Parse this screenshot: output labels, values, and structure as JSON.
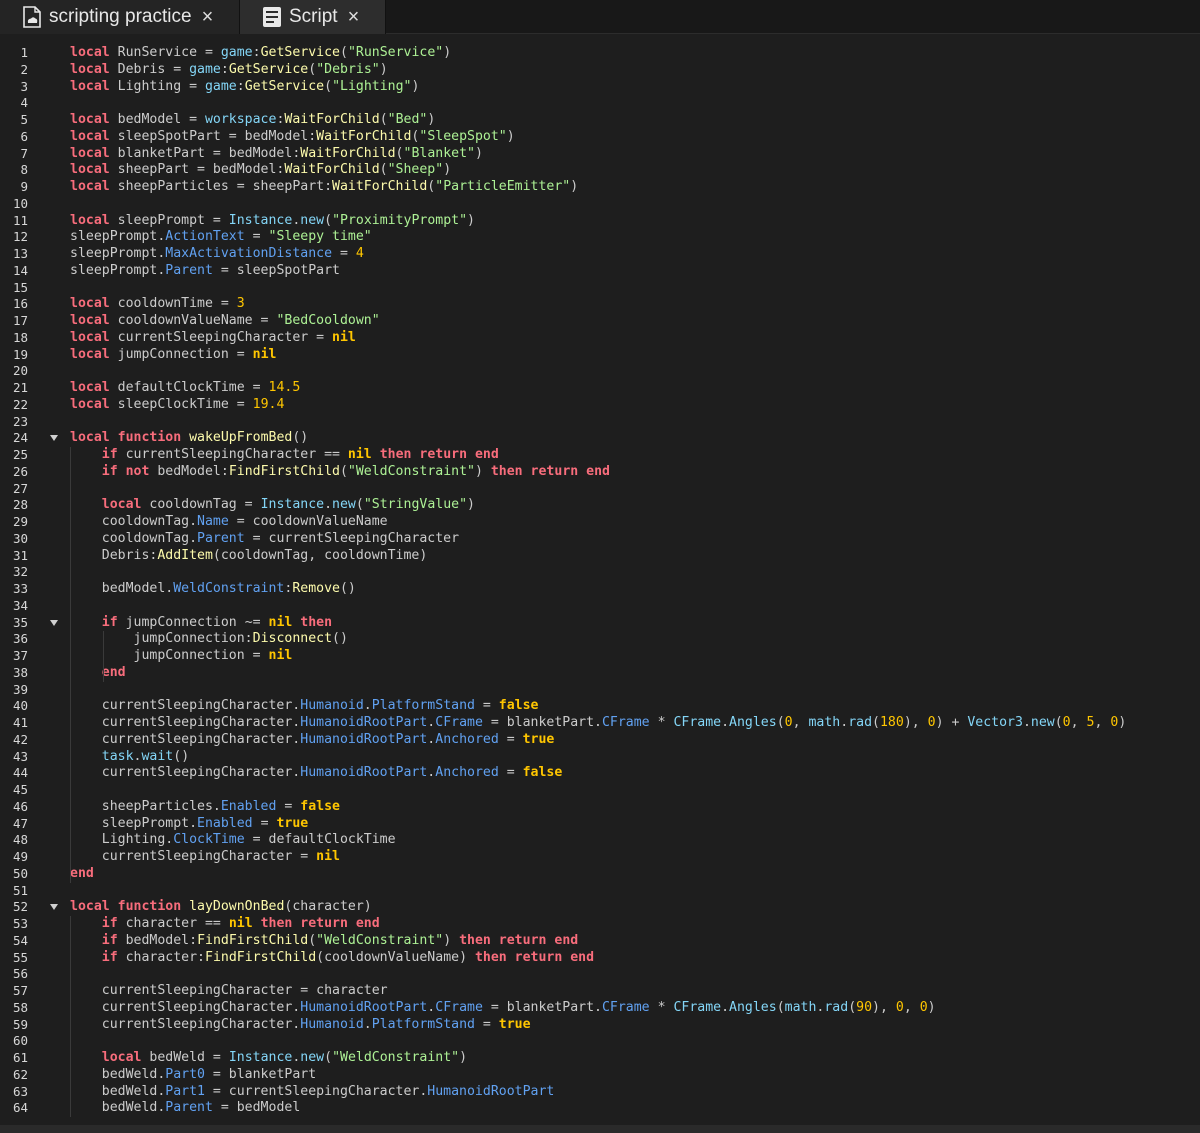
{
  "tabs": [
    {
      "label": "scripting practice",
      "icon": "place-file-icon",
      "close": "×"
    },
    {
      "label": "Script",
      "icon": "script-document-icon",
      "close": "×"
    }
  ],
  "colors": {
    "background": "#1e1e1e",
    "keyword": "#f86d7c",
    "literal": "#ffc600",
    "string": "#adf195",
    "method": "#fdfbac",
    "property": "#61a1f1",
    "builtin": "#84d6f7",
    "text": "#cccccc"
  },
  "fold_lines": [
    24,
    35,
    52
  ],
  "code_lines": [
    [
      [
        "kw",
        "local"
      ],
      [
        "op",
        " RunService = "
      ],
      [
        "blt",
        "game"
      ],
      [
        "op",
        ":"
      ],
      [
        "fn",
        "GetService"
      ],
      [
        "op",
        "("
      ],
      [
        "str",
        "\"RunService\""
      ],
      [
        "op",
        ")"
      ]
    ],
    [
      [
        "kw",
        "local"
      ],
      [
        "op",
        " Debris = "
      ],
      [
        "blt",
        "game"
      ],
      [
        "op",
        ":"
      ],
      [
        "fn",
        "GetService"
      ],
      [
        "op",
        "("
      ],
      [
        "str",
        "\"Debris\""
      ],
      [
        "op",
        ")"
      ]
    ],
    [
      [
        "kw",
        "local"
      ],
      [
        "op",
        " Lighting = "
      ],
      [
        "blt",
        "game"
      ],
      [
        "op",
        ":"
      ],
      [
        "fn",
        "GetService"
      ],
      [
        "op",
        "("
      ],
      [
        "str",
        "\"Lighting\""
      ],
      [
        "op",
        ")"
      ]
    ],
    [],
    [
      [
        "kw",
        "local"
      ],
      [
        "op",
        " bedModel = "
      ],
      [
        "blt",
        "workspace"
      ],
      [
        "op",
        ":"
      ],
      [
        "fn",
        "WaitForChild"
      ],
      [
        "op",
        "("
      ],
      [
        "str",
        "\"Bed\""
      ],
      [
        "op",
        ")"
      ]
    ],
    [
      [
        "kw",
        "local"
      ],
      [
        "op",
        " sleepSpotPart = bedModel:"
      ],
      [
        "fn",
        "WaitForChild"
      ],
      [
        "op",
        "("
      ],
      [
        "str",
        "\"SleepSpot\""
      ],
      [
        "op",
        ")"
      ]
    ],
    [
      [
        "kw",
        "local"
      ],
      [
        "op",
        " blanketPart = bedModel:"
      ],
      [
        "fn",
        "WaitForChild"
      ],
      [
        "op",
        "("
      ],
      [
        "str",
        "\"Blanket\""
      ],
      [
        "op",
        ")"
      ]
    ],
    [
      [
        "kw",
        "local"
      ],
      [
        "op",
        " sheepPart = bedModel:"
      ],
      [
        "fn",
        "WaitForChild"
      ],
      [
        "op",
        "("
      ],
      [
        "str",
        "\"Sheep\""
      ],
      [
        "op",
        ")"
      ]
    ],
    [
      [
        "kw",
        "local"
      ],
      [
        "op",
        " sheepParticles = sheepPart:"
      ],
      [
        "fn",
        "WaitForChild"
      ],
      [
        "op",
        "("
      ],
      [
        "str",
        "\"ParticleEmitter\""
      ],
      [
        "op",
        ")"
      ]
    ],
    [],
    [
      [
        "kw",
        "local"
      ],
      [
        "op",
        " sleepPrompt = "
      ],
      [
        "blt",
        "Instance"
      ],
      [
        "op",
        "."
      ],
      [
        "blt",
        "new"
      ],
      [
        "op",
        "("
      ],
      [
        "str",
        "\"ProximityPrompt\""
      ],
      [
        "op",
        ")"
      ]
    ],
    [
      [
        "op",
        "sleepPrompt."
      ],
      [
        "prop",
        "ActionText"
      ],
      [
        "op",
        " = "
      ],
      [
        "str",
        "\"Sleepy time\""
      ]
    ],
    [
      [
        "op",
        "sleepPrompt."
      ],
      [
        "prop",
        "MaxActivationDistance"
      ],
      [
        "op",
        " = "
      ],
      [
        "num",
        "4"
      ]
    ],
    [
      [
        "op",
        "sleepPrompt."
      ],
      [
        "prop",
        "Parent"
      ],
      [
        "op",
        " = sleepSpotPart"
      ]
    ],
    [],
    [
      [
        "kw",
        "local"
      ],
      [
        "op",
        " cooldownTime = "
      ],
      [
        "num",
        "3"
      ]
    ],
    [
      [
        "kw",
        "local"
      ],
      [
        "op",
        " cooldownValueName = "
      ],
      [
        "str",
        "\"BedCooldown\""
      ]
    ],
    [
      [
        "kw",
        "local"
      ],
      [
        "op",
        " currentSleepingCharacter = "
      ],
      [
        "lit",
        "nil"
      ]
    ],
    [
      [
        "kw",
        "local"
      ],
      [
        "op",
        " jumpConnection = "
      ],
      [
        "lit",
        "nil"
      ]
    ],
    [],
    [
      [
        "kw",
        "local"
      ],
      [
        "op",
        " defaultClockTime = "
      ],
      [
        "num",
        "14.5"
      ]
    ],
    [
      [
        "kw",
        "local"
      ],
      [
        "op",
        " sleepClockTime = "
      ],
      [
        "num",
        "19.4"
      ]
    ],
    [],
    [
      [
        "kw",
        "local function"
      ],
      [
        "op",
        " "
      ],
      [
        "fn",
        "wakeUpFromBed"
      ],
      [
        "op",
        "()"
      ]
    ],
    [
      [
        "op",
        "    "
      ],
      [
        "kw",
        "if"
      ],
      [
        "op",
        " currentSleepingCharacter == "
      ],
      [
        "lit",
        "nil"
      ],
      [
        "op",
        " "
      ],
      [
        "kw",
        "then return end"
      ]
    ],
    [
      [
        "op",
        "    "
      ],
      [
        "kw",
        "if not"
      ],
      [
        "op",
        " bedModel:"
      ],
      [
        "fn",
        "FindFirstChild"
      ],
      [
        "op",
        "("
      ],
      [
        "str",
        "\"WeldConstraint\""
      ],
      [
        "op",
        ") "
      ],
      [
        "kw",
        "then return end"
      ]
    ],
    [],
    [
      [
        "op",
        "    "
      ],
      [
        "kw",
        "local"
      ],
      [
        "op",
        " cooldownTag = "
      ],
      [
        "blt",
        "Instance"
      ],
      [
        "op",
        "."
      ],
      [
        "blt",
        "new"
      ],
      [
        "op",
        "("
      ],
      [
        "str",
        "\"StringValue\""
      ],
      [
        "op",
        ")"
      ]
    ],
    [
      [
        "op",
        "    cooldownTag."
      ],
      [
        "prop",
        "Name"
      ],
      [
        "op",
        " = cooldownValueName"
      ]
    ],
    [
      [
        "op",
        "    cooldownTag."
      ],
      [
        "prop",
        "Parent"
      ],
      [
        "op",
        " = currentSleepingCharacter"
      ]
    ],
    [
      [
        "op",
        "    Debris:"
      ],
      [
        "fn",
        "AddItem"
      ],
      [
        "op",
        "(cooldownTag, cooldownTime)"
      ]
    ],
    [],
    [
      [
        "op",
        "    bedModel."
      ],
      [
        "prop",
        "WeldConstraint"
      ],
      [
        "op",
        ":"
      ],
      [
        "fn",
        "Remove"
      ],
      [
        "op",
        "()"
      ]
    ],
    [],
    [
      [
        "op",
        "    "
      ],
      [
        "kw",
        "if"
      ],
      [
        "op",
        " jumpConnection ~= "
      ],
      [
        "lit",
        "nil"
      ],
      [
        "op",
        " "
      ],
      [
        "kw",
        "then"
      ]
    ],
    [
      [
        "op",
        "        jumpConnection:"
      ],
      [
        "fn",
        "Disconnect"
      ],
      [
        "op",
        "()"
      ]
    ],
    [
      [
        "op",
        "        jumpConnection = "
      ],
      [
        "lit",
        "nil"
      ]
    ],
    [
      [
        "op",
        "    "
      ],
      [
        "kw",
        "end"
      ]
    ],
    [],
    [
      [
        "op",
        "    currentSleepingCharacter."
      ],
      [
        "prop",
        "Humanoid"
      ],
      [
        "op",
        "."
      ],
      [
        "prop",
        "PlatformStand"
      ],
      [
        "op",
        " = "
      ],
      [
        "lit",
        "false"
      ]
    ],
    [
      [
        "op",
        "    currentSleepingCharacter."
      ],
      [
        "prop",
        "HumanoidRootPart"
      ],
      [
        "op",
        "."
      ],
      [
        "prop",
        "CFrame"
      ],
      [
        "op",
        " = blanketPart."
      ],
      [
        "prop",
        "CFrame"
      ],
      [
        "op",
        " * "
      ],
      [
        "blt",
        "CFrame"
      ],
      [
        "op",
        "."
      ],
      [
        "blt",
        "Angles"
      ],
      [
        "op",
        "("
      ],
      [
        "num",
        "0"
      ],
      [
        "op",
        ", "
      ],
      [
        "blt",
        "math"
      ],
      [
        "op",
        "."
      ],
      [
        "blt",
        "rad"
      ],
      [
        "op",
        "("
      ],
      [
        "num",
        "180"
      ],
      [
        "op",
        "), "
      ],
      [
        "num",
        "0"
      ],
      [
        "op",
        ") + "
      ],
      [
        "blt",
        "Vector3"
      ],
      [
        "op",
        "."
      ],
      [
        "blt",
        "new"
      ],
      [
        "op",
        "("
      ],
      [
        "num",
        "0"
      ],
      [
        "op",
        ", "
      ],
      [
        "num",
        "5"
      ],
      [
        "op",
        ", "
      ],
      [
        "num",
        "0"
      ],
      [
        "op",
        ")"
      ]
    ],
    [
      [
        "op",
        "    currentSleepingCharacter."
      ],
      [
        "prop",
        "HumanoidRootPart"
      ],
      [
        "op",
        "."
      ],
      [
        "prop",
        "Anchored"
      ],
      [
        "op",
        " = "
      ],
      [
        "lit",
        "true"
      ]
    ],
    [
      [
        "op",
        "    "
      ],
      [
        "blt",
        "task"
      ],
      [
        "op",
        "."
      ],
      [
        "blt",
        "wait"
      ],
      [
        "op",
        "()"
      ]
    ],
    [
      [
        "op",
        "    currentSleepingCharacter."
      ],
      [
        "prop",
        "HumanoidRootPart"
      ],
      [
        "op",
        "."
      ],
      [
        "prop",
        "Anchored"
      ],
      [
        "op",
        " = "
      ],
      [
        "lit",
        "false"
      ]
    ],
    [],
    [
      [
        "op",
        "    sheepParticles."
      ],
      [
        "prop",
        "Enabled"
      ],
      [
        "op",
        " = "
      ],
      [
        "lit",
        "false"
      ]
    ],
    [
      [
        "op",
        "    sleepPrompt."
      ],
      [
        "prop",
        "Enabled"
      ],
      [
        "op",
        " = "
      ],
      [
        "lit",
        "true"
      ]
    ],
    [
      [
        "op",
        "    Lighting."
      ],
      [
        "prop",
        "ClockTime"
      ],
      [
        "op",
        " = defaultClockTime"
      ]
    ],
    [
      [
        "op",
        "    currentSleepingCharacter = "
      ],
      [
        "lit",
        "nil"
      ]
    ],
    [
      [
        "kw",
        "end"
      ]
    ],
    [],
    [
      [
        "kw",
        "local function"
      ],
      [
        "op",
        " "
      ],
      [
        "fn",
        "layDownOnBed"
      ],
      [
        "op",
        "(character)"
      ]
    ],
    [
      [
        "op",
        "    "
      ],
      [
        "kw",
        "if"
      ],
      [
        "op",
        " character == "
      ],
      [
        "lit",
        "nil"
      ],
      [
        "op",
        " "
      ],
      [
        "kw",
        "then return end"
      ]
    ],
    [
      [
        "op",
        "    "
      ],
      [
        "kw",
        "if"
      ],
      [
        "op",
        " bedModel:"
      ],
      [
        "fn",
        "FindFirstChild"
      ],
      [
        "op",
        "("
      ],
      [
        "str",
        "\"WeldConstraint\""
      ],
      [
        "op",
        ") "
      ],
      [
        "kw",
        "then return end"
      ]
    ],
    [
      [
        "op",
        "    "
      ],
      [
        "kw",
        "if"
      ],
      [
        "op",
        " character:"
      ],
      [
        "fn",
        "FindFirstChild"
      ],
      [
        "op",
        "(cooldownValueName) "
      ],
      [
        "kw",
        "then return end"
      ]
    ],
    [],
    [
      [
        "op",
        "    currentSleepingCharacter = character"
      ]
    ],
    [
      [
        "op",
        "    currentSleepingCharacter."
      ],
      [
        "prop",
        "HumanoidRootPart"
      ],
      [
        "op",
        "."
      ],
      [
        "prop",
        "CFrame"
      ],
      [
        "op",
        " = blanketPart."
      ],
      [
        "prop",
        "CFrame"
      ],
      [
        "op",
        " * "
      ],
      [
        "blt",
        "CFrame"
      ],
      [
        "op",
        "."
      ],
      [
        "blt",
        "Angles"
      ],
      [
        "op",
        "("
      ],
      [
        "blt",
        "math"
      ],
      [
        "op",
        "."
      ],
      [
        "blt",
        "rad"
      ],
      [
        "op",
        "("
      ],
      [
        "num",
        "90"
      ],
      [
        "op",
        "), "
      ],
      [
        "num",
        "0"
      ],
      [
        "op",
        ", "
      ],
      [
        "num",
        "0"
      ],
      [
        "op",
        ")"
      ]
    ],
    [
      [
        "op",
        "    currentSleepingCharacter."
      ],
      [
        "prop",
        "Humanoid"
      ],
      [
        "op",
        "."
      ],
      [
        "prop",
        "PlatformStand"
      ],
      [
        "op",
        " = "
      ],
      [
        "lit",
        "true"
      ]
    ],
    [],
    [
      [
        "op",
        "    "
      ],
      [
        "kw",
        "local"
      ],
      [
        "op",
        " bedWeld = "
      ],
      [
        "blt",
        "Instance"
      ],
      [
        "op",
        "."
      ],
      [
        "blt",
        "new"
      ],
      [
        "op",
        "("
      ],
      [
        "str",
        "\"WeldConstraint\""
      ],
      [
        "op",
        ")"
      ]
    ],
    [
      [
        "op",
        "    bedWeld."
      ],
      [
        "prop",
        "Part0"
      ],
      [
        "op",
        " = blanketPart"
      ]
    ],
    [
      [
        "op",
        "    bedWeld."
      ],
      [
        "prop",
        "Part1"
      ],
      [
        "op",
        " = currentSleepingCharacter."
      ],
      [
        "prop",
        "HumanoidRootPart"
      ]
    ],
    [
      [
        "op",
        "    bedWeld."
      ],
      [
        "prop",
        "Parent"
      ],
      [
        "op",
        " = bedModel"
      ]
    ]
  ]
}
